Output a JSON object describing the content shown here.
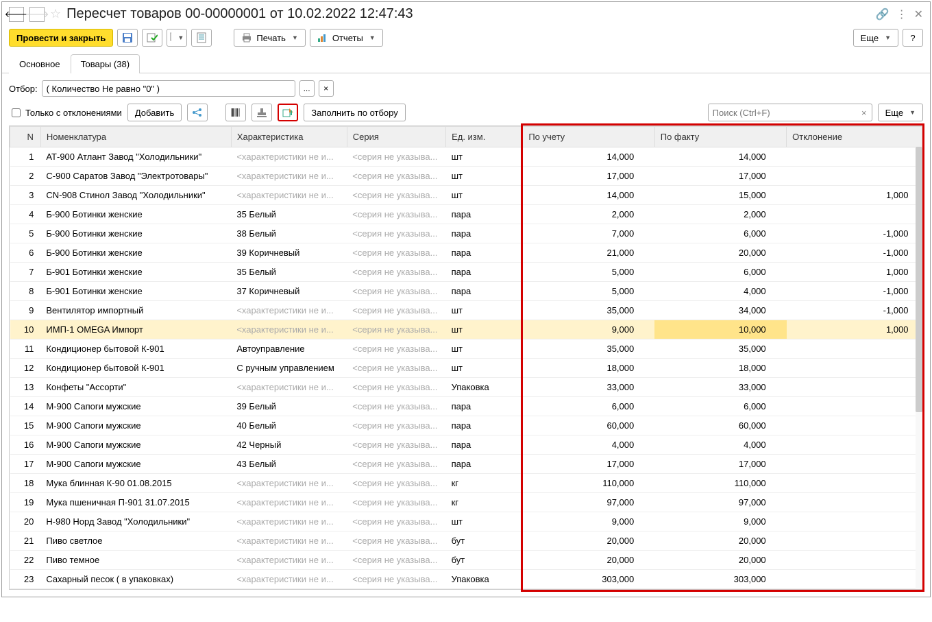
{
  "title": "Пересчет товаров 00-00000001 от 10.02.2022 12:47:43",
  "toolbar": {
    "post_close": "Провести и закрыть",
    "print": "Печать",
    "reports": "Отчеты",
    "more": "Еще",
    "help": "?"
  },
  "tabs": {
    "main": "Основное",
    "goods": "Товары (38)"
  },
  "filter": {
    "label": "Отбор:",
    "value": "( Количество Не равно \"0\" )"
  },
  "table_toolbar": {
    "deviations_only": "Только с отклонениями",
    "add": "Добавить",
    "fill_by_filter": "Заполнить по отбору",
    "search_placeholder": "Поиск (Ctrl+F)",
    "more": "Еще"
  },
  "columns": {
    "n": "N",
    "nom": "Номенклатура",
    "char": "Характеристика",
    "ser": "Серия",
    "unit": "Ед. изм.",
    "acct": "По учету",
    "fact": "По факту",
    "dev": "Отклонение"
  },
  "ph": {
    "char": "<характеристики не и...",
    "ser": "<серия не указыва..."
  },
  "rows": [
    {
      "n": 1,
      "nom": "АТ-900 Атлант Завод \"Холодильники\"",
      "char": null,
      "ser": null,
      "unit": "шт",
      "acct": "14,000",
      "fact": "14,000",
      "dev": ""
    },
    {
      "n": 2,
      "nom": "С-900 Саратов Завод \"Электротовары\"",
      "char": null,
      "ser": null,
      "unit": "шт",
      "acct": "17,000",
      "fact": "17,000",
      "dev": ""
    },
    {
      "n": 3,
      "nom": "CN-908 Стинол Завод \"Холодильники\"",
      "char": null,
      "ser": null,
      "unit": "шт",
      "acct": "14,000",
      "fact": "15,000",
      "dev": "1,000"
    },
    {
      "n": 4,
      "nom": "Б-900 Ботинки женские",
      "char": "35 Белый",
      "ser": null,
      "unit": "пара",
      "acct": "2,000",
      "fact": "2,000",
      "dev": ""
    },
    {
      "n": 5,
      "nom": "Б-900 Ботинки женские",
      "char": "38 Белый",
      "ser": null,
      "unit": "пара",
      "acct": "7,000",
      "fact": "6,000",
      "dev": "-1,000"
    },
    {
      "n": 6,
      "nom": "Б-900 Ботинки женские",
      "char": "39 Коричневый",
      "ser": null,
      "unit": "пара",
      "acct": "21,000",
      "fact": "20,000",
      "dev": "-1,000"
    },
    {
      "n": 7,
      "nom": "Б-901 Ботинки женские",
      "char": "35 Белый",
      "ser": null,
      "unit": "пара",
      "acct": "5,000",
      "fact": "6,000",
      "dev": "1,000"
    },
    {
      "n": 8,
      "nom": "Б-901 Ботинки женские",
      "char": "37 Коричневый",
      "ser": null,
      "unit": "пара",
      "acct": "5,000",
      "fact": "4,000",
      "dev": "-1,000"
    },
    {
      "n": 9,
      "nom": "Вентилятор импортный",
      "char": null,
      "ser": null,
      "unit": "шт",
      "acct": "35,000",
      "fact": "34,000",
      "dev": "-1,000"
    },
    {
      "n": 10,
      "nom": "ИМП-1 OMEGA Импорт",
      "char": null,
      "ser": null,
      "unit": "шт",
      "acct": "9,000",
      "fact": "10,000",
      "dev": "1,000",
      "selected": true,
      "activeCol": "fact"
    },
    {
      "n": 11,
      "nom": "Кондиционер бытовой К-901",
      "char": "Автоуправление",
      "ser": null,
      "unit": "шт",
      "acct": "35,000",
      "fact": "35,000",
      "dev": ""
    },
    {
      "n": 12,
      "nom": "Кондиционер бытовой К-901",
      "char": "С ручным управлением",
      "ser": null,
      "unit": "шт",
      "acct": "18,000",
      "fact": "18,000",
      "dev": ""
    },
    {
      "n": 13,
      "nom": "Конфеты \"Ассорти\"",
      "char": null,
      "ser": null,
      "unit": "Упаковка",
      "acct": "33,000",
      "fact": "33,000",
      "dev": ""
    },
    {
      "n": 14,
      "nom": "М-900 Сапоги мужские",
      "char": "39 Белый",
      "ser": null,
      "unit": "пара",
      "acct": "6,000",
      "fact": "6,000",
      "dev": ""
    },
    {
      "n": 15,
      "nom": "М-900 Сапоги мужские",
      "char": "40 Белый",
      "ser": null,
      "unit": "пара",
      "acct": "60,000",
      "fact": "60,000",
      "dev": ""
    },
    {
      "n": 16,
      "nom": "М-900 Сапоги мужские",
      "char": "42 Черный",
      "ser": null,
      "unit": "пара",
      "acct": "4,000",
      "fact": "4,000",
      "dev": ""
    },
    {
      "n": 17,
      "nom": "М-900 Сапоги мужские",
      "char": "43 Белый",
      "ser": null,
      "unit": "пара",
      "acct": "17,000",
      "fact": "17,000",
      "dev": ""
    },
    {
      "n": 18,
      "nom": "Мука блинная  К-90 01.08.2015",
      "char": null,
      "ser": null,
      "unit": "кг",
      "acct": "110,000",
      "fact": "110,000",
      "dev": ""
    },
    {
      "n": 19,
      "nom": "Мука пшеничная П-901  31.07.2015",
      "char": null,
      "ser": null,
      "unit": "кг",
      "acct": "97,000",
      "fact": "97,000",
      "dev": ""
    },
    {
      "n": 20,
      "nom": "Н-980 Норд Завод \"Холодильники\"",
      "char": null,
      "ser": null,
      "unit": "шт",
      "acct": "9,000",
      "fact": "9,000",
      "dev": ""
    },
    {
      "n": 21,
      "nom": "Пиво светлое",
      "char": null,
      "ser": null,
      "unit": "бут",
      "acct": "20,000",
      "fact": "20,000",
      "dev": ""
    },
    {
      "n": 22,
      "nom": "Пиво темное",
      "char": null,
      "ser": null,
      "unit": "бут",
      "acct": "20,000",
      "fact": "20,000",
      "dev": ""
    },
    {
      "n": 23,
      "nom": "Сахарный песок ( в упаковках)",
      "char": null,
      "ser": null,
      "unit": "Упаковка",
      "acct": "303,000",
      "fact": "303,000",
      "dev": ""
    }
  ]
}
